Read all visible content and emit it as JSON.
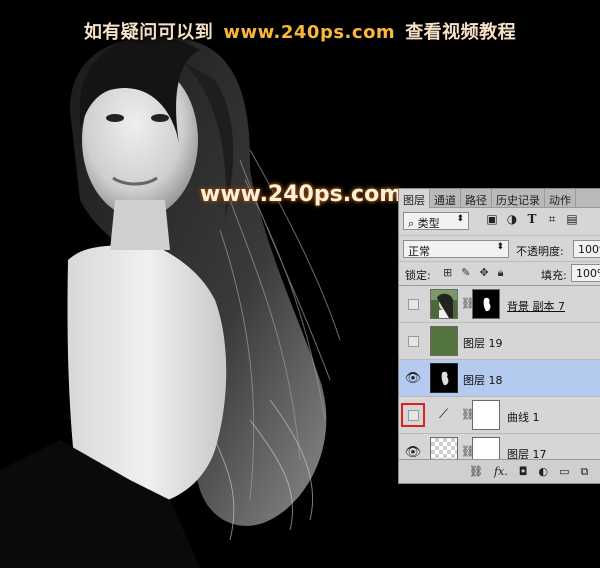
{
  "watermark": {
    "top_left": "如有疑问可以到",
    "top_url": "www.240ps.com",
    "top_right": "查看视频教程",
    "center": "www.240ps.com"
  },
  "panel": {
    "tabs": [
      "图层",
      "通道",
      "路径",
      "历史记录",
      "动作"
    ],
    "filter_kind": "类型",
    "blend_mode": "正常",
    "opacity_label": "不透明度:",
    "opacity_value": "100%",
    "lock_label": "锁定:",
    "fill_label": "填充:",
    "fill_value": "100%",
    "layers": [
      {
        "name": "背景 副本 7",
        "visible": false,
        "selected": false
      },
      {
        "name": "图层 19",
        "visible": false,
        "selected": false,
        "swatch": "#54743e"
      },
      {
        "name": "图层 18",
        "visible": true,
        "selected": true
      },
      {
        "name": "曲线 1",
        "visible": false,
        "selected": false,
        "highlighted_toggle": true
      },
      {
        "name": "图层 17",
        "visible": true,
        "selected": false
      }
    ],
    "footer_icons": [
      "link-icon",
      "fx-icon",
      "mask-icon",
      "adjustment-icon",
      "group-icon",
      "new-layer-icon"
    ]
  },
  "colors": {
    "selected_row": "#b4cbef",
    "highlight_box": "#e0201e",
    "watermark_url": "#f8b93a"
  }
}
